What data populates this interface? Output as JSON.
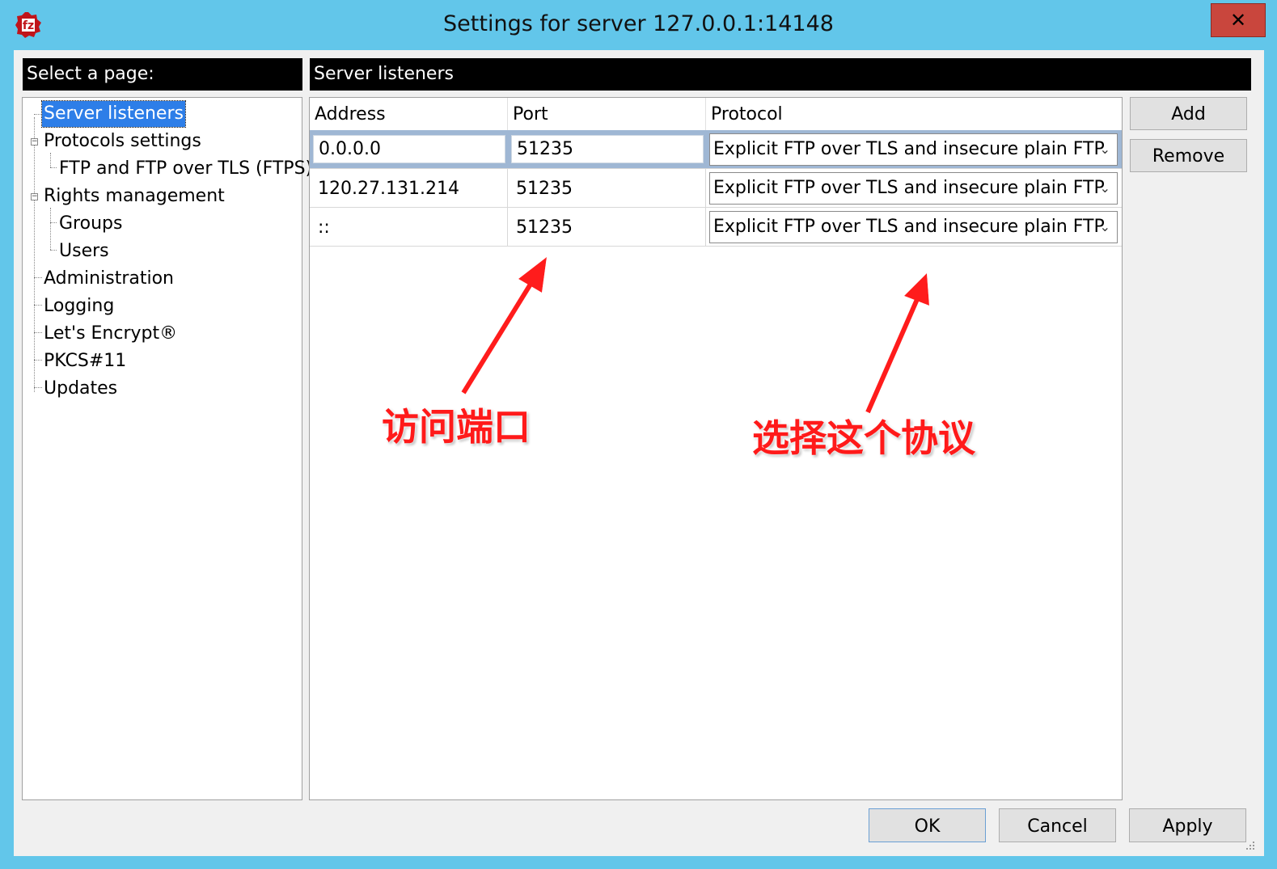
{
  "window": {
    "title": "Settings for server 127.0.0.1:14148",
    "close_label": "✕"
  },
  "left_pane": {
    "header": "Select a page:",
    "tree": [
      {
        "label": "Server listeners",
        "selected": true
      },
      {
        "label": "Protocols settings"
      },
      {
        "label": "FTP and FTP over TLS (FTPS)"
      },
      {
        "label": "Rights management"
      },
      {
        "label": "Groups"
      },
      {
        "label": "Users"
      },
      {
        "label": "Administration"
      },
      {
        "label": "Logging"
      },
      {
        "label": "Let's Encrypt®"
      },
      {
        "label": "PKCS#11"
      },
      {
        "label": "Updates"
      }
    ]
  },
  "right_pane": {
    "header": "Server listeners",
    "columns": [
      "Address",
      "Port",
      "Protocol"
    ],
    "rows": [
      {
        "address": "0.0.0.0",
        "port": "51235",
        "protocol": "Explicit FTP over TLS and insecure plain FTP"
      },
      {
        "address": "120.27.131.214",
        "port": "51235",
        "protocol": "Explicit FTP over TLS and insecure plain FTP"
      },
      {
        "address": "::",
        "port": "51235",
        "protocol": "Explicit FTP over TLS and insecure plain FTP"
      }
    ]
  },
  "side_buttons": {
    "add": "Add",
    "remove": "Remove"
  },
  "footer_buttons": {
    "ok": "OK",
    "cancel": "Cancel",
    "apply": "Apply"
  },
  "annotations": {
    "port_note": "访问端口",
    "protocol_note": "选择这个协议",
    "color": "#ff1a1a"
  }
}
